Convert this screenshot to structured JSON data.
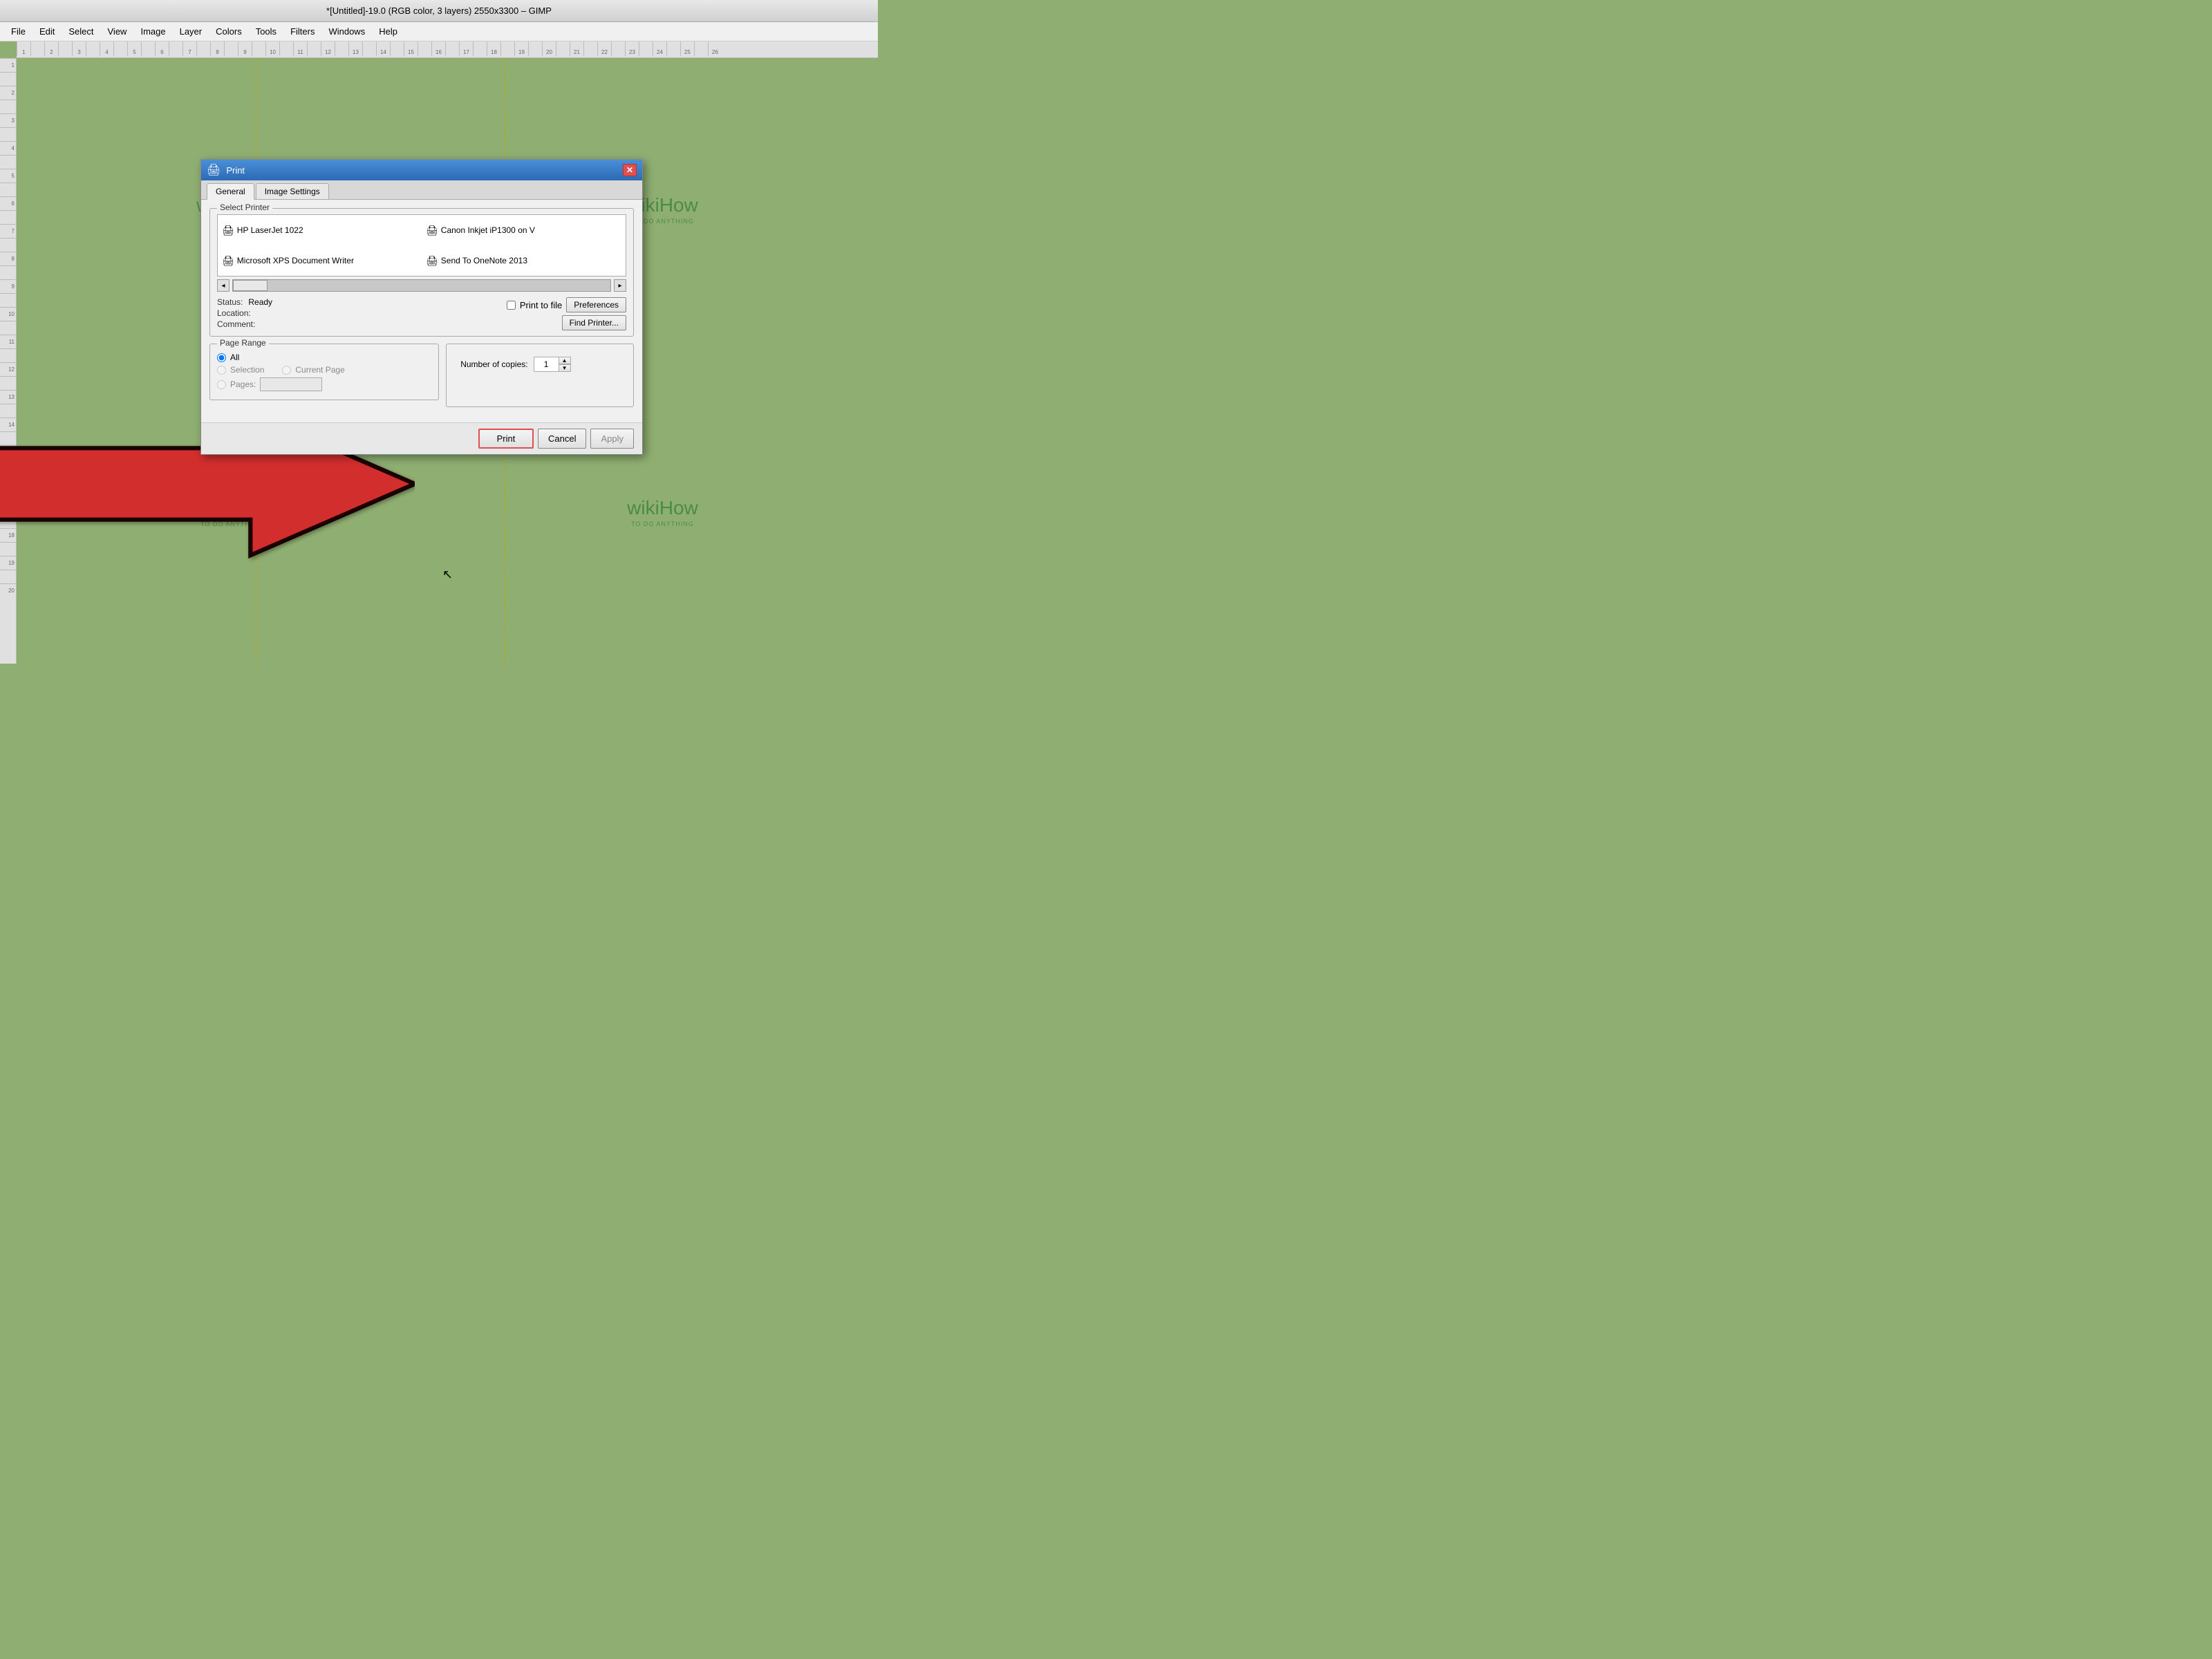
{
  "titlebar": {
    "title": "*[Untitled]-19.0 (RGB color, 3 layers) 2550x3300 – GIMP"
  },
  "menubar": {
    "items": [
      "File",
      "Edit",
      "Select",
      "View",
      "Image",
      "Layer",
      "Colors",
      "Tools",
      "Filters",
      "Windows",
      "Help"
    ]
  },
  "dialog": {
    "title": "Print",
    "tabs": [
      "General",
      "Image Settings"
    ],
    "active_tab": "General",
    "printer_section_label": "Select Printer",
    "printers": [
      {
        "name": "HP LaserJet 1022",
        "icon": "🖨"
      },
      {
        "name": "Canon Inkjet iP1300 on V",
        "icon": "🖨"
      },
      {
        "name": "Microsoft XPS Document Writer",
        "icon": "🖨"
      },
      {
        "name": "Send To OneNote 2013",
        "icon": "🖨"
      }
    ],
    "status_label": "Status:",
    "status_value": "Ready",
    "location_label": "Location:",
    "location_value": "",
    "comment_label": "Comment:",
    "comment_value": "",
    "print_to_file_label": "Print to file",
    "preferences_btn": "Preferences",
    "find_printer_btn": "Find Printer...",
    "page_range_label": "Page Range",
    "radio_all": "All",
    "radio_selection": "Selection",
    "radio_current_page": "Current Page",
    "radio_pages": "Pages:",
    "copies_label": "Number of copies:",
    "copies_value": "1",
    "print_btn": "Print",
    "cancel_btn": "Cancel",
    "apply_btn": "Apply"
  },
  "wikihow": {
    "brand": "wikiHow",
    "brand_bold": "wiki",
    "brand_normal": "How",
    "tagline": "TO DO ANYTHING"
  },
  "arrow": {
    "color": "#d32f2f"
  }
}
